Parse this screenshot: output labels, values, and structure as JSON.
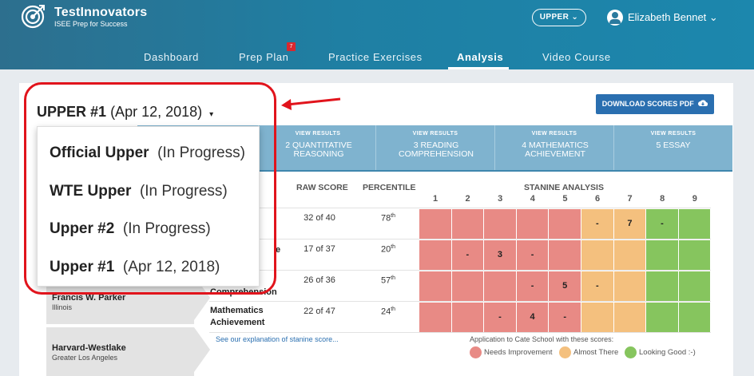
{
  "brand": {
    "name": "TestInnovators",
    "tagline": "ISEE Prep for Success"
  },
  "header": {
    "level": "UPPER",
    "level_caret": "⌄",
    "user": "Elizabeth Bennet",
    "user_caret": "⌄"
  },
  "nav": [
    {
      "label": "Dashboard",
      "active": false
    },
    {
      "label": "Prep Plan",
      "active": false,
      "badge": "7"
    },
    {
      "label": "Practice Exercises",
      "active": false
    },
    {
      "label": "Analysis",
      "active": true
    },
    {
      "label": "Video Course",
      "active": false
    }
  ],
  "exam": {
    "name": "UPPER #1",
    "date": "(Apr 12, 2018)",
    "caret": "▾"
  },
  "download_button": "DOWNLOAD SCORES PDF",
  "tabs": [
    {
      "view": "VIEW RESULTS",
      "name": "2 QUANTITATIVE REASONING"
    },
    {
      "view": "VIEW RESULTS",
      "name": "3 READING COMPREHENSION"
    },
    {
      "view": "VIEW RESULTS",
      "name": "4 MATHEMATICS ACHIEVEMENT"
    },
    {
      "view": "VIEW RESULTS",
      "name": "5 ESSAY"
    }
  ],
  "table": {
    "headers": {
      "raw": "RAW SCORE",
      "percentile": "PERCENTILE",
      "stanine": "STANINE ANALYSIS"
    },
    "stanine_numbers": [
      "1",
      "2",
      "3",
      "4",
      "5",
      "6",
      "7",
      "8",
      "9"
    ],
    "rows": [
      {
        "label": "",
        "raw": "32 of 40",
        "pct": "78",
        "pct_suffix": "th",
        "cells": [
          "",
          "",
          "",
          "",
          "",
          "-",
          "7",
          "-",
          ""
        ]
      },
      {
        "label": "e",
        "raw": "17 of 37",
        "pct": "20",
        "pct_suffix": "th",
        "cells": [
          "",
          "-",
          "3",
          "-",
          "",
          "",
          "",
          "",
          ""
        ]
      },
      {
        "label": "Comprehension",
        "raw": "26 of 36",
        "pct": "57",
        "pct_suffix": "th",
        "cells": [
          "",
          "",
          "",
          "-",
          "5",
          "-",
          "",
          "",
          ""
        ]
      },
      {
        "label": "Mathematics Achievement",
        "raw": "22 of 47",
        "pct": "24",
        "pct_suffix": "th",
        "cells": [
          "",
          "",
          "-",
          "4",
          "-",
          "",
          "",
          "",
          ""
        ]
      }
    ],
    "cell_colors": [
      [
        "red",
        "red",
        "red",
        "red",
        "red",
        "orange",
        "orange",
        "green",
        "green"
      ],
      [
        "red",
        "red",
        "red",
        "red",
        "red",
        "orange",
        "orange",
        "green",
        "green"
      ],
      [
        "red",
        "red",
        "red",
        "red",
        "red",
        "orange",
        "orange",
        "green",
        "green"
      ],
      [
        "red",
        "red",
        "red",
        "red",
        "red",
        "orange",
        "orange",
        "green",
        "green"
      ]
    ]
  },
  "schools": [
    {
      "name": "Francis W. Parker",
      "location": "Illinois"
    },
    {
      "name": "Harvard-Westlake",
      "location": "Greater Los Angeles"
    }
  ],
  "explain_link": "See our explanation of stanine score...",
  "legend": {
    "title": "Application to Cate School with these scores:",
    "items": [
      {
        "label": "Needs Improvement",
        "color": "#e88a85"
      },
      {
        "label": "Almost There",
        "color": "#f4c07e"
      },
      {
        "label": "Looking Good :-)",
        "color": "#86c55e"
      }
    ]
  },
  "dropdown": [
    {
      "name": "Official Upper",
      "status": "(In Progress)"
    },
    {
      "name": "WTE Upper",
      "status": "(In Progress)"
    },
    {
      "name": "Upper #2",
      "status": "(In Progress)"
    },
    {
      "name": "Upper #1",
      "status": "(Apr 12, 2018)"
    }
  ],
  "colors": {
    "red": "#e88a85",
    "orange": "#f4c07e",
    "green": "#86c55e",
    "highlight": "#e1141c"
  }
}
